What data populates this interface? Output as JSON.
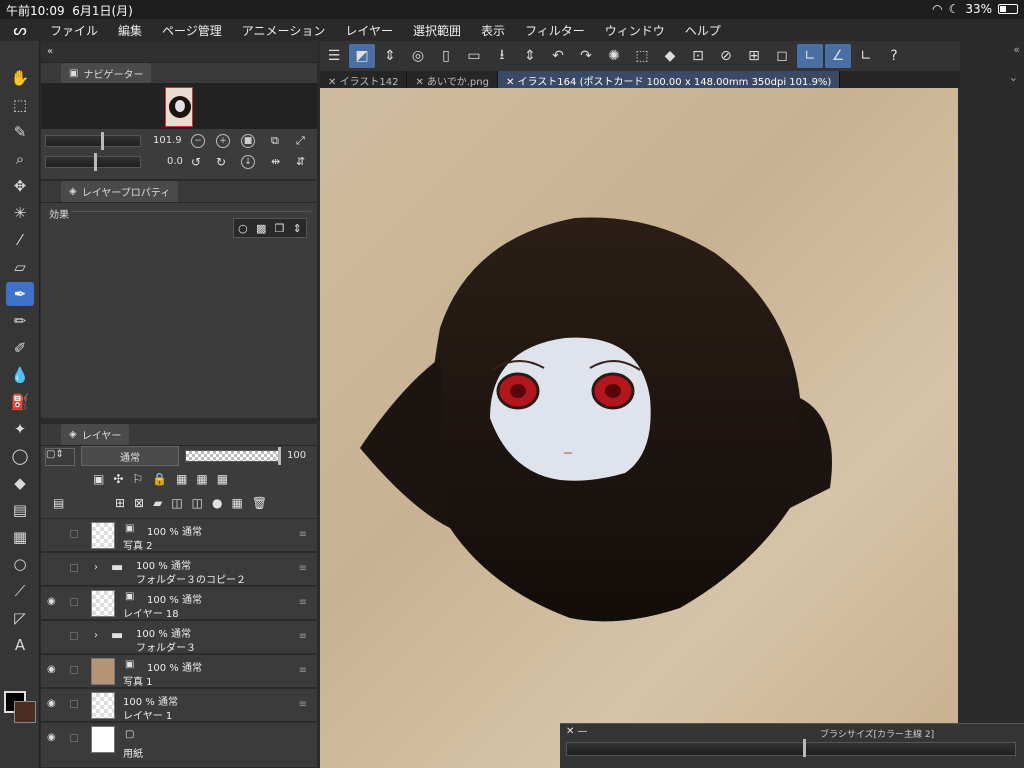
{
  "status": {
    "time": "午前10:09",
    "date": "6月1日(月)",
    "battery": "33%"
  },
  "menu": [
    "ファイル",
    "編集",
    "ページ管理",
    "アニメーション",
    "レイヤー",
    "選択範囲",
    "表示",
    "フィルター",
    "ウィンドウ",
    "ヘルプ"
  ],
  "navigator": {
    "title": "ナビゲーター",
    "zoom": "101.9",
    "rotation": "0.0"
  },
  "layer_property": {
    "title": "レイヤープロパティ",
    "effect_label": "効果"
  },
  "layers_panel": {
    "title": "レイヤー",
    "blend": "通常",
    "opacity": "100"
  },
  "layers": [
    {
      "line1": "100 % 通常",
      "line2": "写真 2",
      "visible": false
    },
    {
      "line1": "100 % 通常",
      "line2": "フォルダー３のコピー２",
      "visible": false,
      "folder": true
    },
    {
      "line1": "100 % 通常",
      "line2": "レイヤー 18",
      "visible": true
    },
    {
      "line1": "100 % 通常",
      "line2": "フォルダー３",
      "visible": false,
      "folder": true
    },
    {
      "line1": "100 % 通常",
      "line2": "写真 1",
      "visible": true
    },
    {
      "line1": "100 % 通常",
      "line2": "レイヤー 1",
      "visible": true
    },
    {
      "line1": "",
      "line2": "用紙",
      "visible": true
    }
  ],
  "doc_tabs": [
    "イラスト142",
    "あいでか.png",
    "イラスト164 (ポストカード 100.00 x 148.00mm 350dpi 101.9%)"
  ],
  "brush_panel": {
    "title": "ブラシサイズ[カラー主線 2]"
  },
  "colors": {
    "accent": "#3e72c8"
  }
}
